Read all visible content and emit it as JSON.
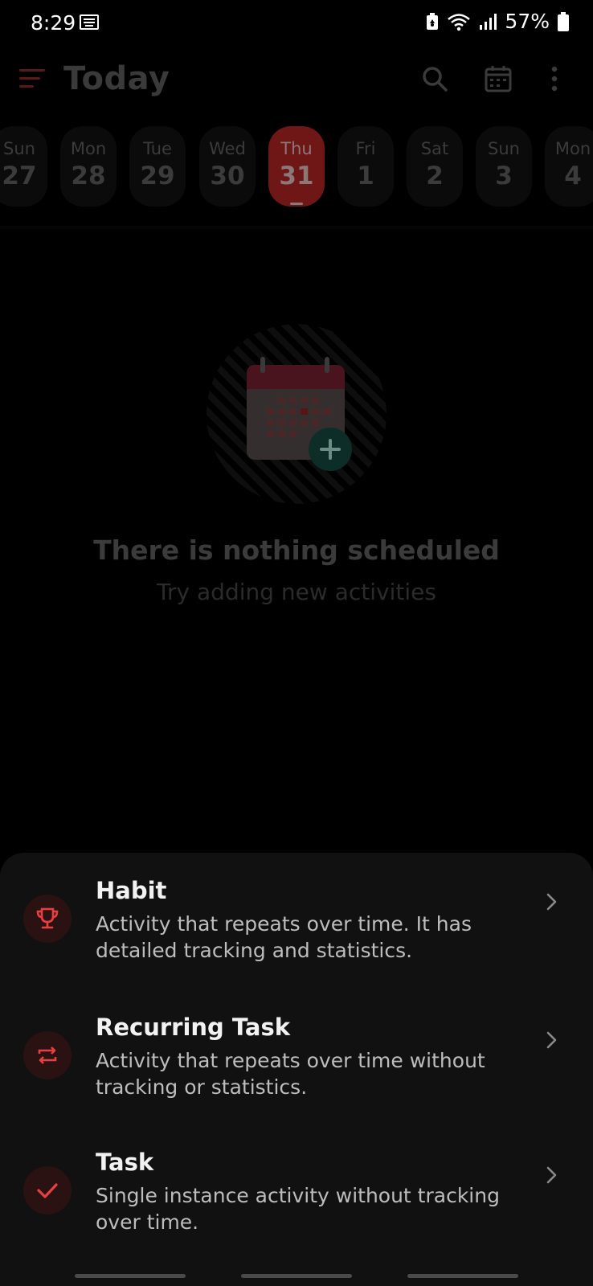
{
  "status_bar": {
    "time": "8:29",
    "battery": "57%"
  },
  "header": {
    "title": "Today",
    "accent_color": "#d63a3a"
  },
  "week": [
    {
      "day": "Sun",
      "date": "27",
      "selected": false
    },
    {
      "day": "Mon",
      "date": "28",
      "selected": false
    },
    {
      "day": "Tue",
      "date": "29",
      "selected": false
    },
    {
      "day": "Wed",
      "date": "30",
      "selected": false
    },
    {
      "day": "Thu",
      "date": "31",
      "selected": true
    },
    {
      "day": "Fri",
      "date": "1",
      "selected": false
    },
    {
      "day": "Sat",
      "date": "2",
      "selected": false
    },
    {
      "day": "Sun",
      "date": "3",
      "selected": false
    },
    {
      "day": "Mon",
      "date": "4",
      "selected": false
    }
  ],
  "empty_state": {
    "title": "There is nothing scheduled",
    "subtitle": "Try adding new activities"
  },
  "sheet": {
    "options": [
      {
        "title": "Habit",
        "description": "Activity that repeats over time. It has detailed tracking and statistics.",
        "icon": "trophy-icon"
      },
      {
        "title": "Recurring Task",
        "description": "Activity that repeats over time without tracking or statistics.",
        "icon": "repeat-icon"
      },
      {
        "title": "Task",
        "description": "Single instance activity without tracking over time.",
        "icon": "check-icon"
      }
    ]
  }
}
